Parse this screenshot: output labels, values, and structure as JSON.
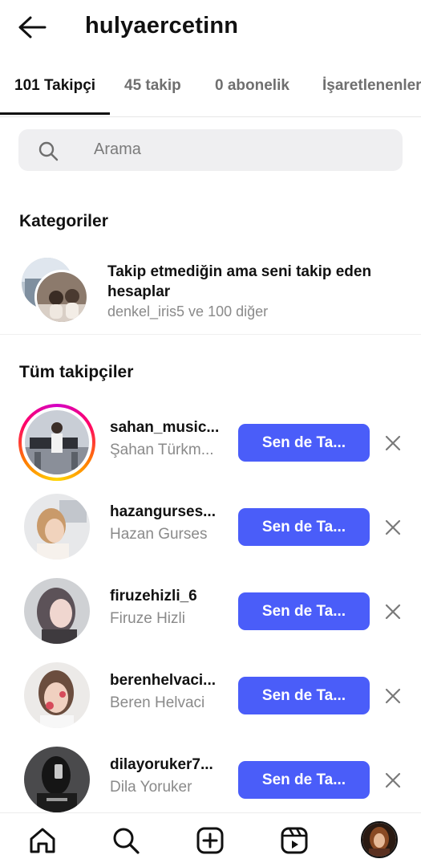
{
  "header": {
    "title": "hulyaercetinn",
    "back_icon": "arrow-left-icon"
  },
  "tabs": [
    {
      "label": "101 Takipçi",
      "active": true
    },
    {
      "label": "45 takip",
      "active": false
    },
    {
      "label": "0 abonelik",
      "active": false
    },
    {
      "label": "İşaretlenenler",
      "active": false
    }
  ],
  "search": {
    "placeholder": "Arama",
    "icon": "search-icon"
  },
  "categories": {
    "title": "Kategoriler",
    "item": {
      "title": "Takip etmediğin ama seni takip eden hesaplar",
      "subtitle": "denkel_iris5 ve 100 diğer"
    }
  },
  "followers": {
    "title": "Tüm takipçiler",
    "button_label": "Sen de Ta...",
    "items": [
      {
        "username": "sahan_music...",
        "fullname": "Şahan Türkm...",
        "has_story": true
      },
      {
        "username": "hazangurses...",
        "fullname": "Hazan Gurses",
        "has_story": false
      },
      {
        "username": "firuzehizli_6",
        "fullname": "Firuze Hizli",
        "has_story": false
      },
      {
        "username": "berenhelvaci...",
        "fullname": "Beren Helvaci",
        "has_story": false
      },
      {
        "username": "dilayoruker7...",
        "fullname": "Dila Yoruker",
        "has_story": false
      }
    ]
  },
  "bottom_nav": {
    "items": [
      "home-icon",
      "search-icon",
      "create-icon",
      "reels-icon",
      "profile-avatar"
    ]
  },
  "colors": {
    "accent": "#4a5df9",
    "secondary_text": "#8a8a8a",
    "search_bg": "#efeff1"
  }
}
